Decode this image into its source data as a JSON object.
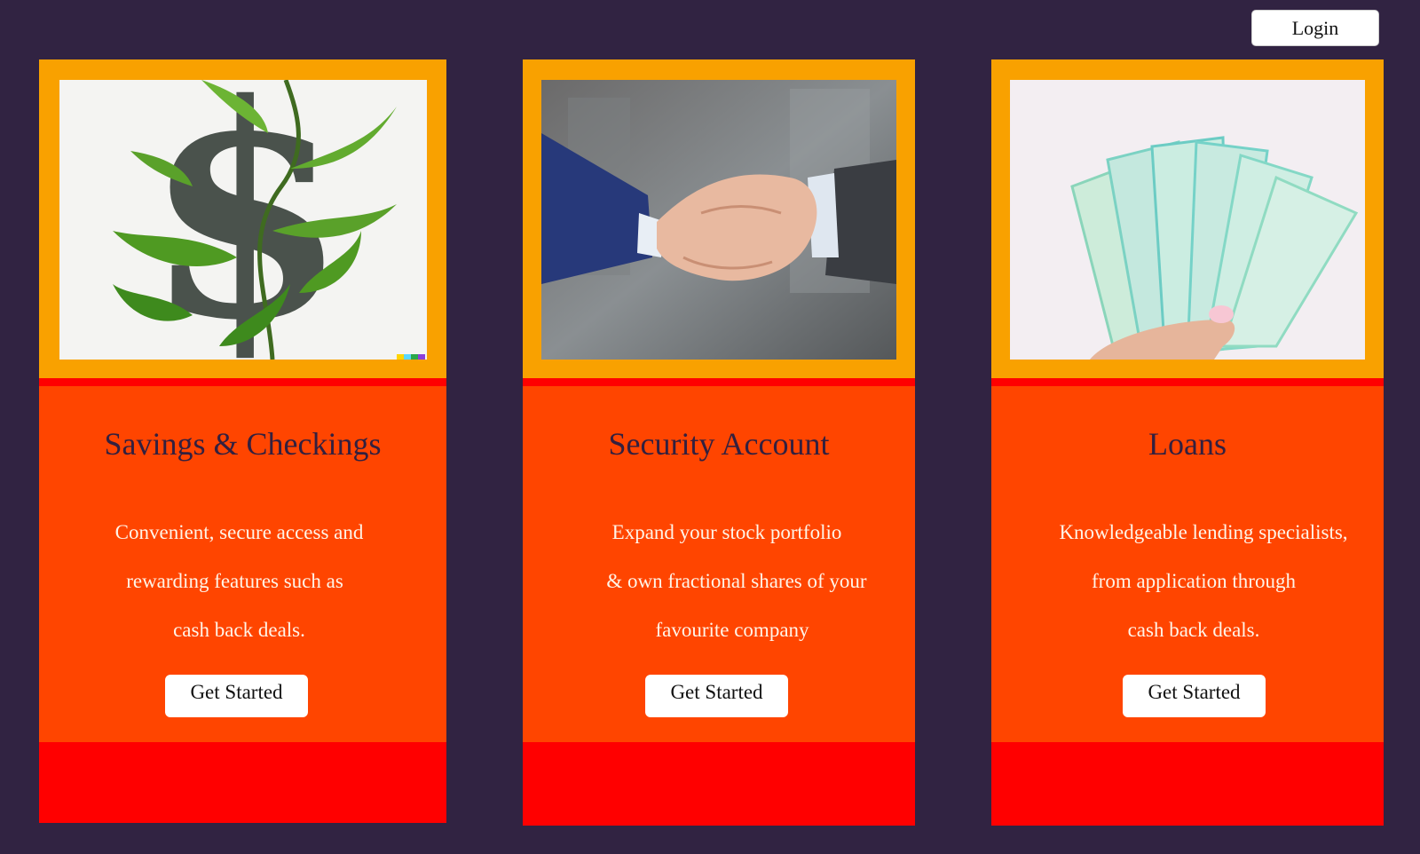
{
  "header": {
    "login_label": "Login"
  },
  "cards": [
    {
      "title": "Savings & Checkings",
      "description_lines": [
        "Convenient, secure access and",
        "rewarding features such as",
        "cash back deals."
      ],
      "button_label": "Get Started",
      "image": "dollar-sign-with-leaves"
    },
    {
      "title": "Security Account",
      "description_lines": [
        "Expand your stock portfolio",
        "& own fractional shares of your",
        "favourite company"
      ],
      "button_label": "Get Started",
      "image": "business-handshake"
    },
    {
      "title": "Loans",
      "description_lines": [
        "Knowledgeable lending specialists,",
        "from application through",
        "cash back deals."
      ],
      "button_label": "Get Started",
      "image": "hand-holding-banknotes"
    }
  ],
  "colors": {
    "page_background": "#312342",
    "card_frame": "#f9a100",
    "card_body": "#ff4500",
    "card_stripe": "#ff0000",
    "title_text": "#33203f",
    "desc_text": "#fff4e8"
  }
}
